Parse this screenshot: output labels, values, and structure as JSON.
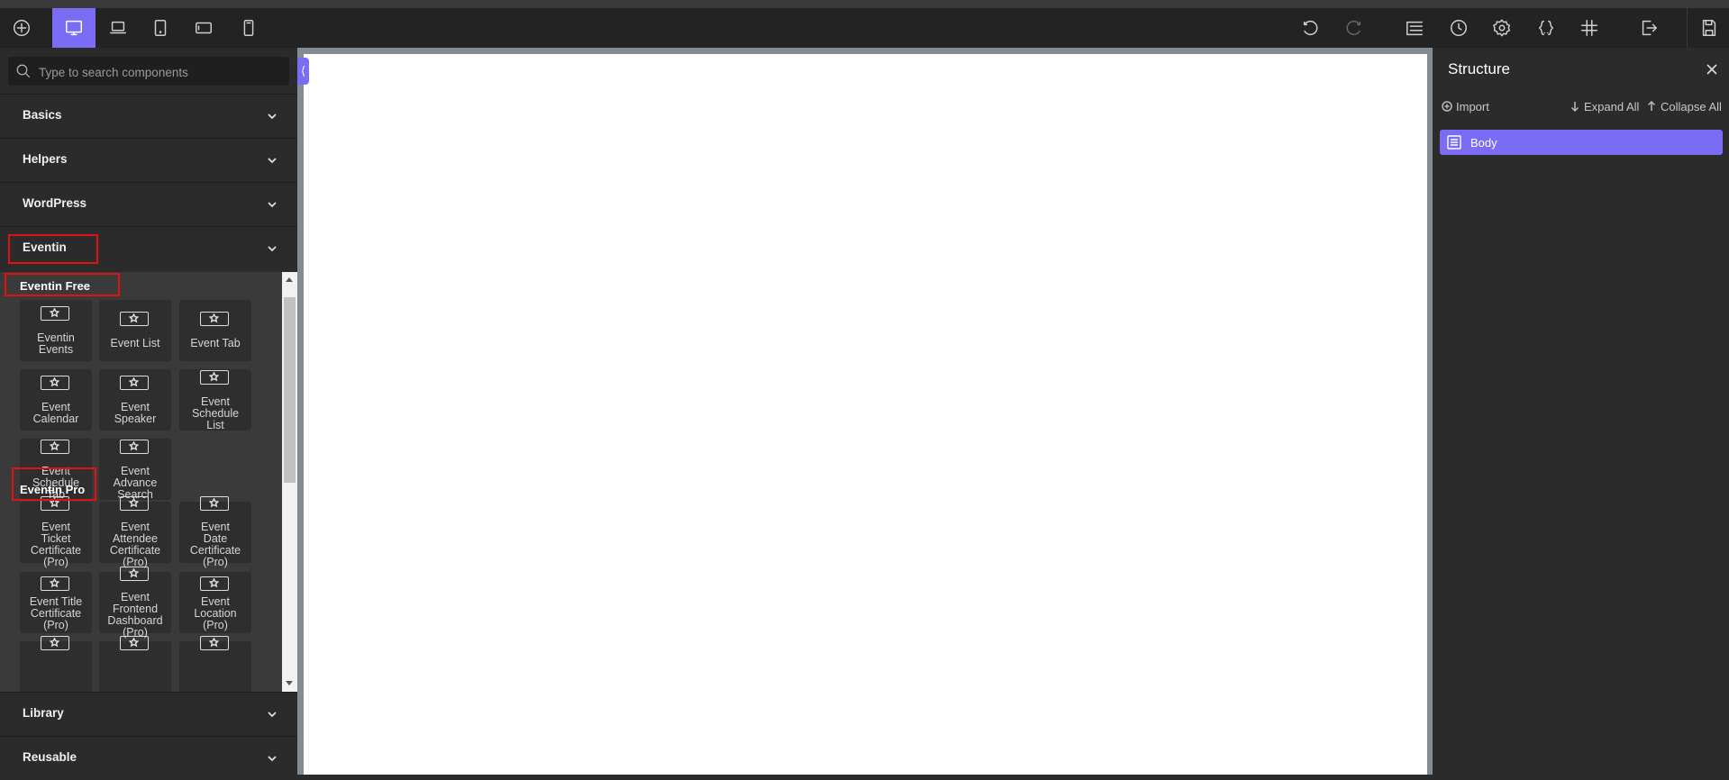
{
  "toolbar": {
    "left_icons": [
      "add-icon",
      "desktop-icon",
      "laptop-icon",
      "tablet-portrait-icon",
      "tablet-landscape-icon",
      "mobile-icon"
    ],
    "active_device": "desktop",
    "right_icons": [
      "undo-icon",
      "redo-icon",
      "structure-panel-icon",
      "history-icon",
      "settings-icon",
      "code-braces-icon",
      "grid-hash-icon",
      "exit-icon",
      "save-icon"
    ]
  },
  "search": {
    "placeholder": "Type to search components"
  },
  "categories": {
    "basics": "Basics",
    "helpers": "Helpers",
    "wordpress": "WordPress",
    "eventin": "Eventin",
    "library": "Library",
    "reusable": "Reusable"
  },
  "eventin": {
    "free_label": "Eventin Free",
    "pro_label": "Eventin Pro",
    "free_items": [
      [
        "Eventin",
        "Events"
      ],
      [
        "Event List"
      ],
      [
        "Event Tab"
      ],
      [
        "Event",
        "Calendar"
      ],
      [
        "Event",
        "Speaker"
      ],
      [
        "Event",
        "Schedule",
        "List"
      ],
      [
        "Event",
        "Schedule",
        "Tab"
      ],
      [
        "Event",
        "Advance",
        "Search"
      ]
    ],
    "pro_items": [
      [
        "Event",
        "Ticket",
        "Certificate",
        "(Pro)"
      ],
      [
        "Event",
        "Attendee",
        "Certificate",
        "(Pro)"
      ],
      [
        "Event",
        "Date",
        "Certificate",
        "(Pro)"
      ],
      [
        "Event Title",
        "Certificate",
        "(Pro)"
      ],
      [
        "Event",
        "Frontend",
        "Dashboard",
        "(Pro)"
      ],
      [
        "Event",
        "Location",
        "(Pro)"
      ]
    ]
  },
  "structure": {
    "title": "Structure",
    "import": "Import",
    "expand_all": "Expand All",
    "collapse_all": "Collapse All",
    "root_item": "Body"
  },
  "colors": {
    "accent": "#7b6cf6",
    "highlight": "#e01212"
  }
}
